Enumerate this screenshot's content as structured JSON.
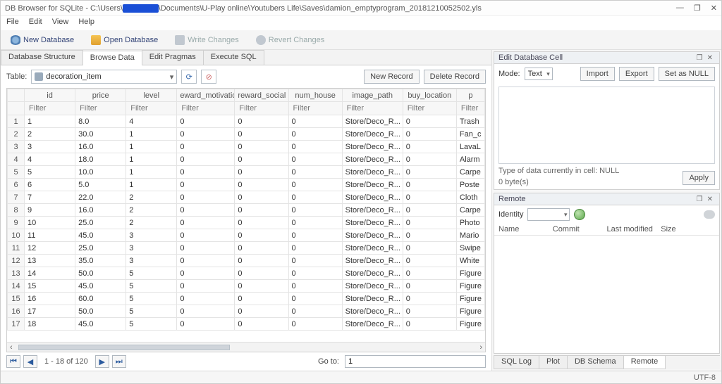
{
  "title_prefix": "DB Browser for SQLite - C:\\Users\\",
  "title_redacted": "██████",
  "title_suffix": "\\Documents\\U-Play online\\Youtubers Life\\Saves\\damion_emptyprogram_20181210052502.yls",
  "menu": {
    "file": "File",
    "edit": "Edit",
    "view": "View",
    "help": "Help"
  },
  "toolbar": {
    "new_db": "New Database",
    "open_db": "Open Database",
    "write": "Write Changes",
    "revert": "Revert Changes"
  },
  "tabs": {
    "structure": "Database Structure",
    "browse": "Browse Data",
    "pragmas": "Edit Pragmas",
    "sql": "Execute SQL"
  },
  "table_label": "Table:",
  "table_selected": "decoration_item",
  "btn_new_record": "New Record",
  "btn_delete_record": "Delete Record",
  "columns": [
    "id",
    "price",
    "level",
    "eward_motivatio",
    "reward_social",
    "num_house",
    "image_path",
    "buy_location",
    "p"
  ],
  "filter_placeholder": "Filter",
  "rows": [
    {
      "n": "1",
      "id": "1",
      "price": "8.0",
      "level": "4",
      "rm": "0",
      "rs": "0",
      "nh": "0",
      "ip": "Store/Deco_R...",
      "bl": "0",
      "p": "Trash"
    },
    {
      "n": "2",
      "id": "2",
      "price": "30.0",
      "level": "1",
      "rm": "0",
      "rs": "0",
      "nh": "0",
      "ip": "Store/Deco_R...",
      "bl": "0",
      "p": "Fan_c"
    },
    {
      "n": "3",
      "id": "3",
      "price": "16.0",
      "level": "1",
      "rm": "0",
      "rs": "0",
      "nh": "0",
      "ip": "Store/Deco_R...",
      "bl": "0",
      "p": "LavaL"
    },
    {
      "n": "4",
      "id": "4",
      "price": "18.0",
      "level": "1",
      "rm": "0",
      "rs": "0",
      "nh": "0",
      "ip": "Store/Deco_R...",
      "bl": "0",
      "p": "Alarm"
    },
    {
      "n": "5",
      "id": "5",
      "price": "10.0",
      "level": "1",
      "rm": "0",
      "rs": "0",
      "nh": "0",
      "ip": "Store/Deco_R...",
      "bl": "0",
      "p": "Carpe"
    },
    {
      "n": "6",
      "id": "6",
      "price": "5.0",
      "level": "1",
      "rm": "0",
      "rs": "0",
      "nh": "0",
      "ip": "Store/Deco_R...",
      "bl": "0",
      "p": "Poste"
    },
    {
      "n": "7",
      "id": "7",
      "price": "22.0",
      "level": "2",
      "rm": "0",
      "rs": "0",
      "nh": "0",
      "ip": "Store/Deco_R...",
      "bl": "0",
      "p": "Cloth"
    },
    {
      "n": "8",
      "id": "9",
      "price": "16.0",
      "level": "2",
      "rm": "0",
      "rs": "0",
      "nh": "0",
      "ip": "Store/Deco_R...",
      "bl": "0",
      "p": "Carpe"
    },
    {
      "n": "9",
      "id": "10",
      "price": "25.0",
      "level": "2",
      "rm": "0",
      "rs": "0",
      "nh": "0",
      "ip": "Store/Deco_R...",
      "bl": "0",
      "p": "Photo"
    },
    {
      "n": "10",
      "id": "11",
      "price": "45.0",
      "level": "3",
      "rm": "0",
      "rs": "0",
      "nh": "0",
      "ip": "Store/Deco_R...",
      "bl": "0",
      "p": "Mario"
    },
    {
      "n": "11",
      "id": "12",
      "price": "25.0",
      "level": "3",
      "rm": "0",
      "rs": "0",
      "nh": "0",
      "ip": "Store/Deco_R...",
      "bl": "0",
      "p": "Swipe"
    },
    {
      "n": "12",
      "id": "13",
      "price": "35.0",
      "level": "3",
      "rm": "0",
      "rs": "0",
      "nh": "0",
      "ip": "Store/Deco_R...",
      "bl": "0",
      "p": "White"
    },
    {
      "n": "13",
      "id": "14",
      "price": "50.0",
      "level": "5",
      "rm": "0",
      "rs": "0",
      "nh": "0",
      "ip": "Store/Deco_R...",
      "bl": "0",
      "p": "Figure"
    },
    {
      "n": "14",
      "id": "15",
      "price": "45.0",
      "level": "5",
      "rm": "0",
      "rs": "0",
      "nh": "0",
      "ip": "Store/Deco_R...",
      "bl": "0",
      "p": "Figure"
    },
    {
      "n": "15",
      "id": "16",
      "price": "60.0",
      "level": "5",
      "rm": "0",
      "rs": "0",
      "nh": "0",
      "ip": "Store/Deco_R...",
      "bl": "0",
      "p": "Figure"
    },
    {
      "n": "16",
      "id": "17",
      "price": "50.0",
      "level": "5",
      "rm": "0",
      "rs": "0",
      "nh": "0",
      "ip": "Store/Deco_R...",
      "bl": "0",
      "p": "Figure"
    },
    {
      "n": "17",
      "id": "18",
      "price": "45.0",
      "level": "5",
      "rm": "0",
      "rs": "0",
      "nh": "0",
      "ip": "Store/Deco_R...",
      "bl": "0",
      "p": "Figure"
    }
  ],
  "nav_range": "1 - 18 of 120",
  "goto_label": "Go to:",
  "goto_value": "1",
  "edit_panel": {
    "title": "Edit Database Cell",
    "mode_label": "Mode:",
    "mode_value": "Text",
    "import": "Import",
    "export": "Export",
    "set_null": "Set as NULL",
    "type_text": "Type of data currently in cell: NULL",
    "bytes_text": "0 byte(s)",
    "apply": "Apply"
  },
  "remote_panel": {
    "title": "Remote",
    "identity_label": "Identity",
    "cols": {
      "name": "Name",
      "commit": "Commit",
      "last_modified": "Last modified",
      "size": "Size"
    }
  },
  "bottom_tabs": {
    "sqllog": "SQL Log",
    "plot": "Plot",
    "dbschema": "DB Schema",
    "remote": "Remote"
  },
  "status_encoding": "UTF-8"
}
